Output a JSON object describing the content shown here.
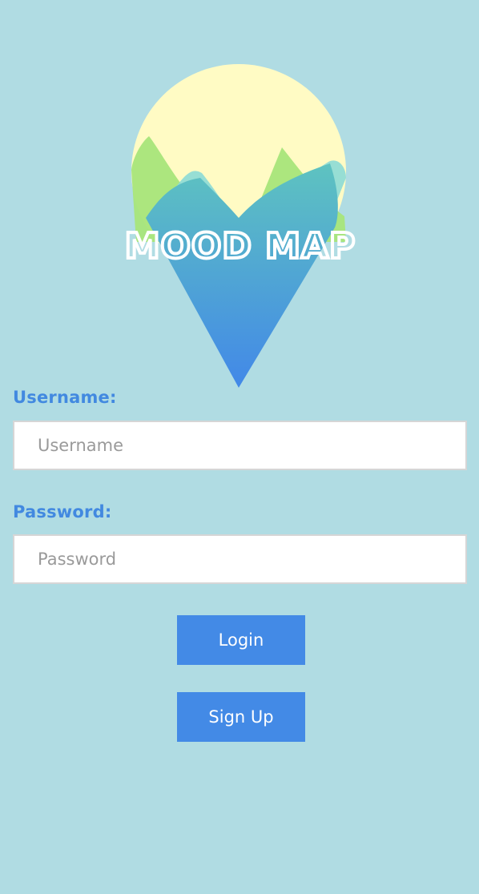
{
  "app": {
    "logo_text": "MOOD MAP"
  },
  "form": {
    "username_label": "Username:",
    "username_placeholder": "Username",
    "username_value": "",
    "password_label": "Password:",
    "password_placeholder": "Password",
    "password_value": ""
  },
  "buttons": {
    "login_label": "Login",
    "signup_label": "Sign Up"
  },
  "colors": {
    "background": "#b0dce3",
    "accent": "#438ae6",
    "sun": "#fffbc4",
    "hill_green": "#a8e57a",
    "hill_teal": "#8cdad6"
  }
}
